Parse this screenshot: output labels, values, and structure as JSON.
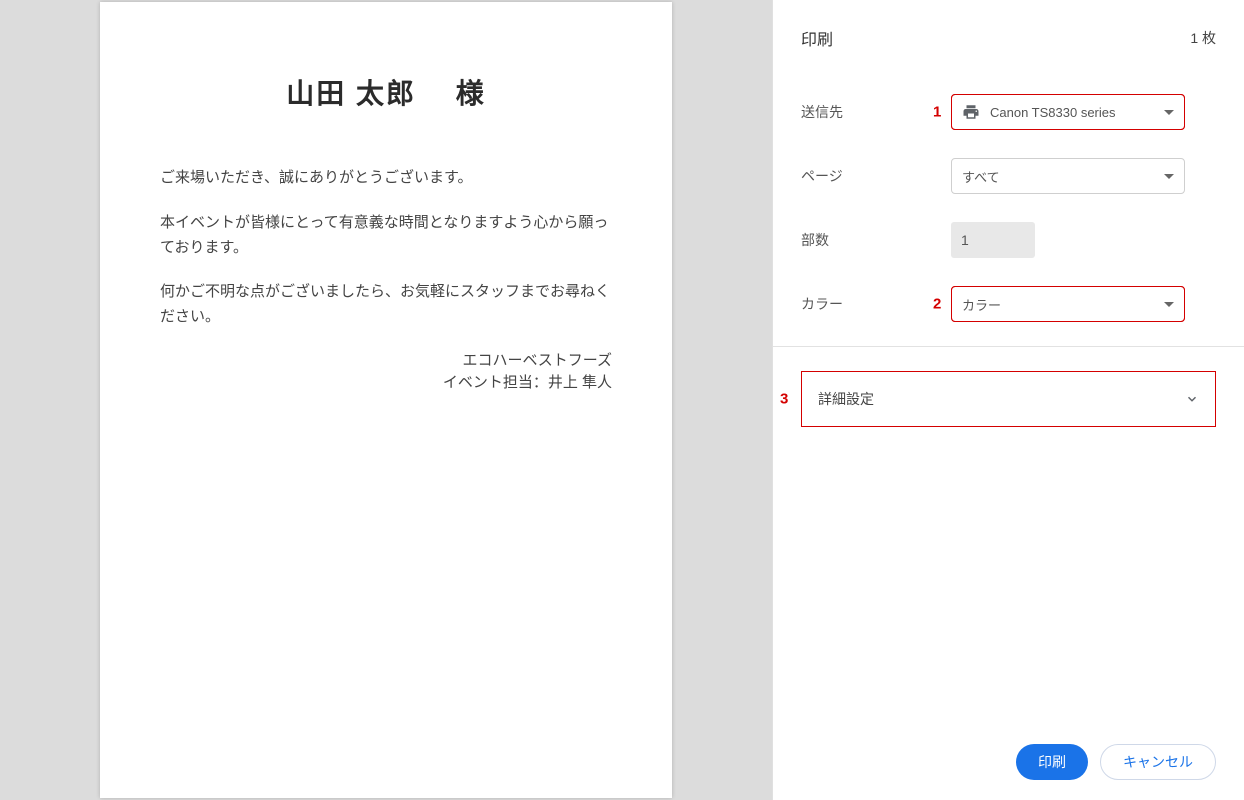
{
  "preview": {
    "title": "山田 太郎　 様",
    "para1": "ご来場いただき、誠にありがとうございます。",
    "para2": "本イベントが皆様にとって有意義な時間となりますよう心から願っております。",
    "para3": "何かご不明な点がございましたら、お気軽にスタッフまでお尋ねください。",
    "sign1": "エコハーベストフーズ",
    "sign2": "イベント担当：井上 隼人"
  },
  "header": {
    "title": "印刷",
    "sheets": "1 枚"
  },
  "settings": {
    "destination_label": "送信先",
    "destination_value": "Canon TS8330 series",
    "pages_label": "ページ",
    "pages_value": "すべて",
    "copies_label": "部数",
    "copies_value": "1",
    "color_label": "カラー",
    "color_value": "カラー"
  },
  "advanced": {
    "label": "詳細設定"
  },
  "annotations": {
    "n1": "1",
    "n2": "2",
    "n3": "3"
  },
  "footer": {
    "print": "印刷",
    "cancel": "キャンセル"
  }
}
